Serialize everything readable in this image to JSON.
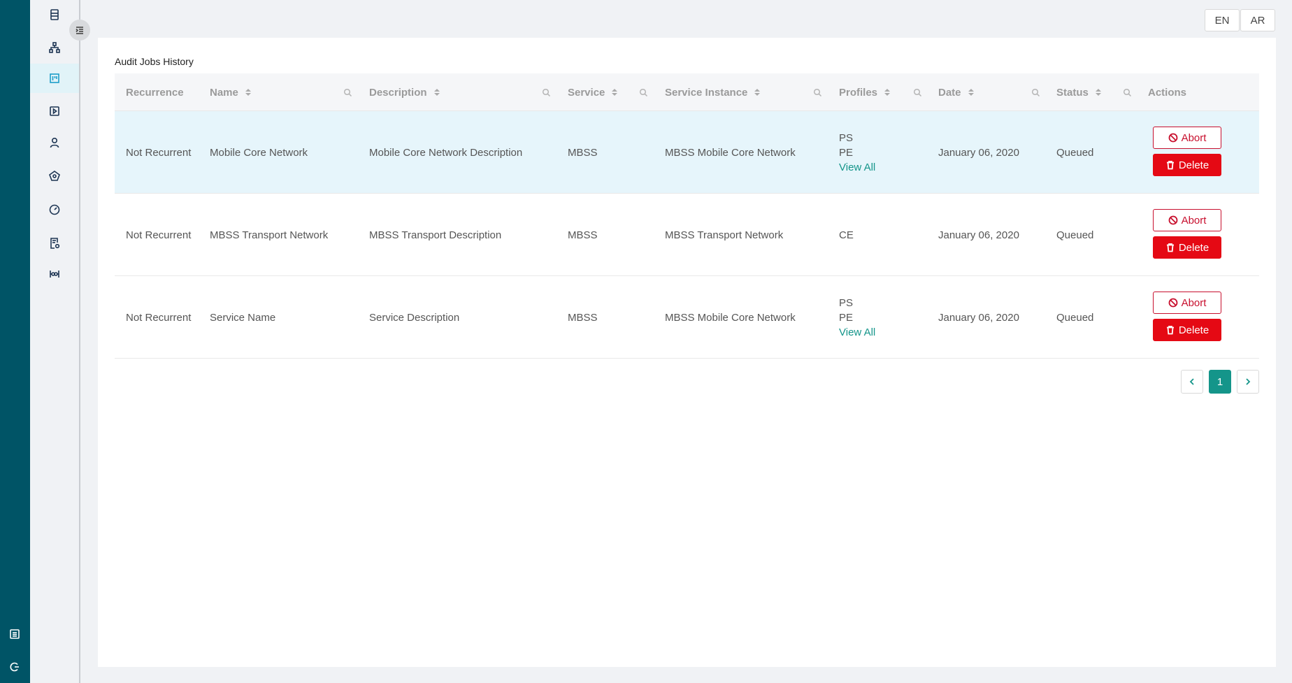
{
  "language": {
    "en": "EN",
    "ar": "AR"
  },
  "sidebar": {
    "items": [
      {
        "icon": "database-icon"
      },
      {
        "icon": "hierarchy-icon"
      },
      {
        "icon": "board-icon",
        "active": true
      },
      {
        "icon": "play-icon"
      },
      {
        "icon": "user-icon"
      },
      {
        "icon": "network-icon"
      },
      {
        "icon": "gauge-icon"
      },
      {
        "icon": "report-settings-icon"
      },
      {
        "icon": "tools-icon"
      }
    ],
    "bottom": [
      {
        "icon": "list-icon"
      },
      {
        "icon": "logout-icon"
      }
    ]
  },
  "page": {
    "title": "Audit Jobs History"
  },
  "table": {
    "columns": [
      "Recurrence",
      "Name",
      "Description",
      "Service",
      "Service Instance",
      "Profiles",
      "Date",
      "Status",
      "Actions"
    ],
    "rows": [
      {
        "recurrence": "Not Recurrent",
        "name": "Mobile Core Network",
        "description": "Mobile Core Network Description",
        "service": "MBSS",
        "service_instance": "MBSS Mobile Core Network",
        "profiles": [
          "PS",
          "PE"
        ],
        "view_all": "View All",
        "date": "January 06, 2020",
        "status": "Queued",
        "abort_label": "Abort",
        "delete_label": "Delete",
        "highlighted": true
      },
      {
        "recurrence": "Not Recurrent",
        "name": "MBSS Transport Network",
        "description": "MBSS Transport Description",
        "service": "MBSS",
        "service_instance": "MBSS Transport Network",
        "profiles": [
          "CE"
        ],
        "view_all": "",
        "date": "January 06, 2020",
        "status": "Queued",
        "abort_label": "Abort",
        "delete_label": "Delete",
        "highlighted": false
      },
      {
        "recurrence": "Not Recurrent",
        "name": "Service Name",
        "description": "Service Description",
        "service": "MBSS",
        "service_instance": "MBSS Mobile Core Network",
        "profiles": [
          "PS",
          "PE"
        ],
        "view_all": "View All",
        "date": "January 06, 2020",
        "status": "Queued",
        "abort_label": "Abort",
        "delete_label": "Delete",
        "highlighted": false
      }
    ]
  },
  "pagination": {
    "current": "1"
  },
  "colors": {
    "rail": "#005466",
    "accent": "#14958a",
    "danger": "#e50914",
    "highlight_row": "#e6f5fb"
  }
}
